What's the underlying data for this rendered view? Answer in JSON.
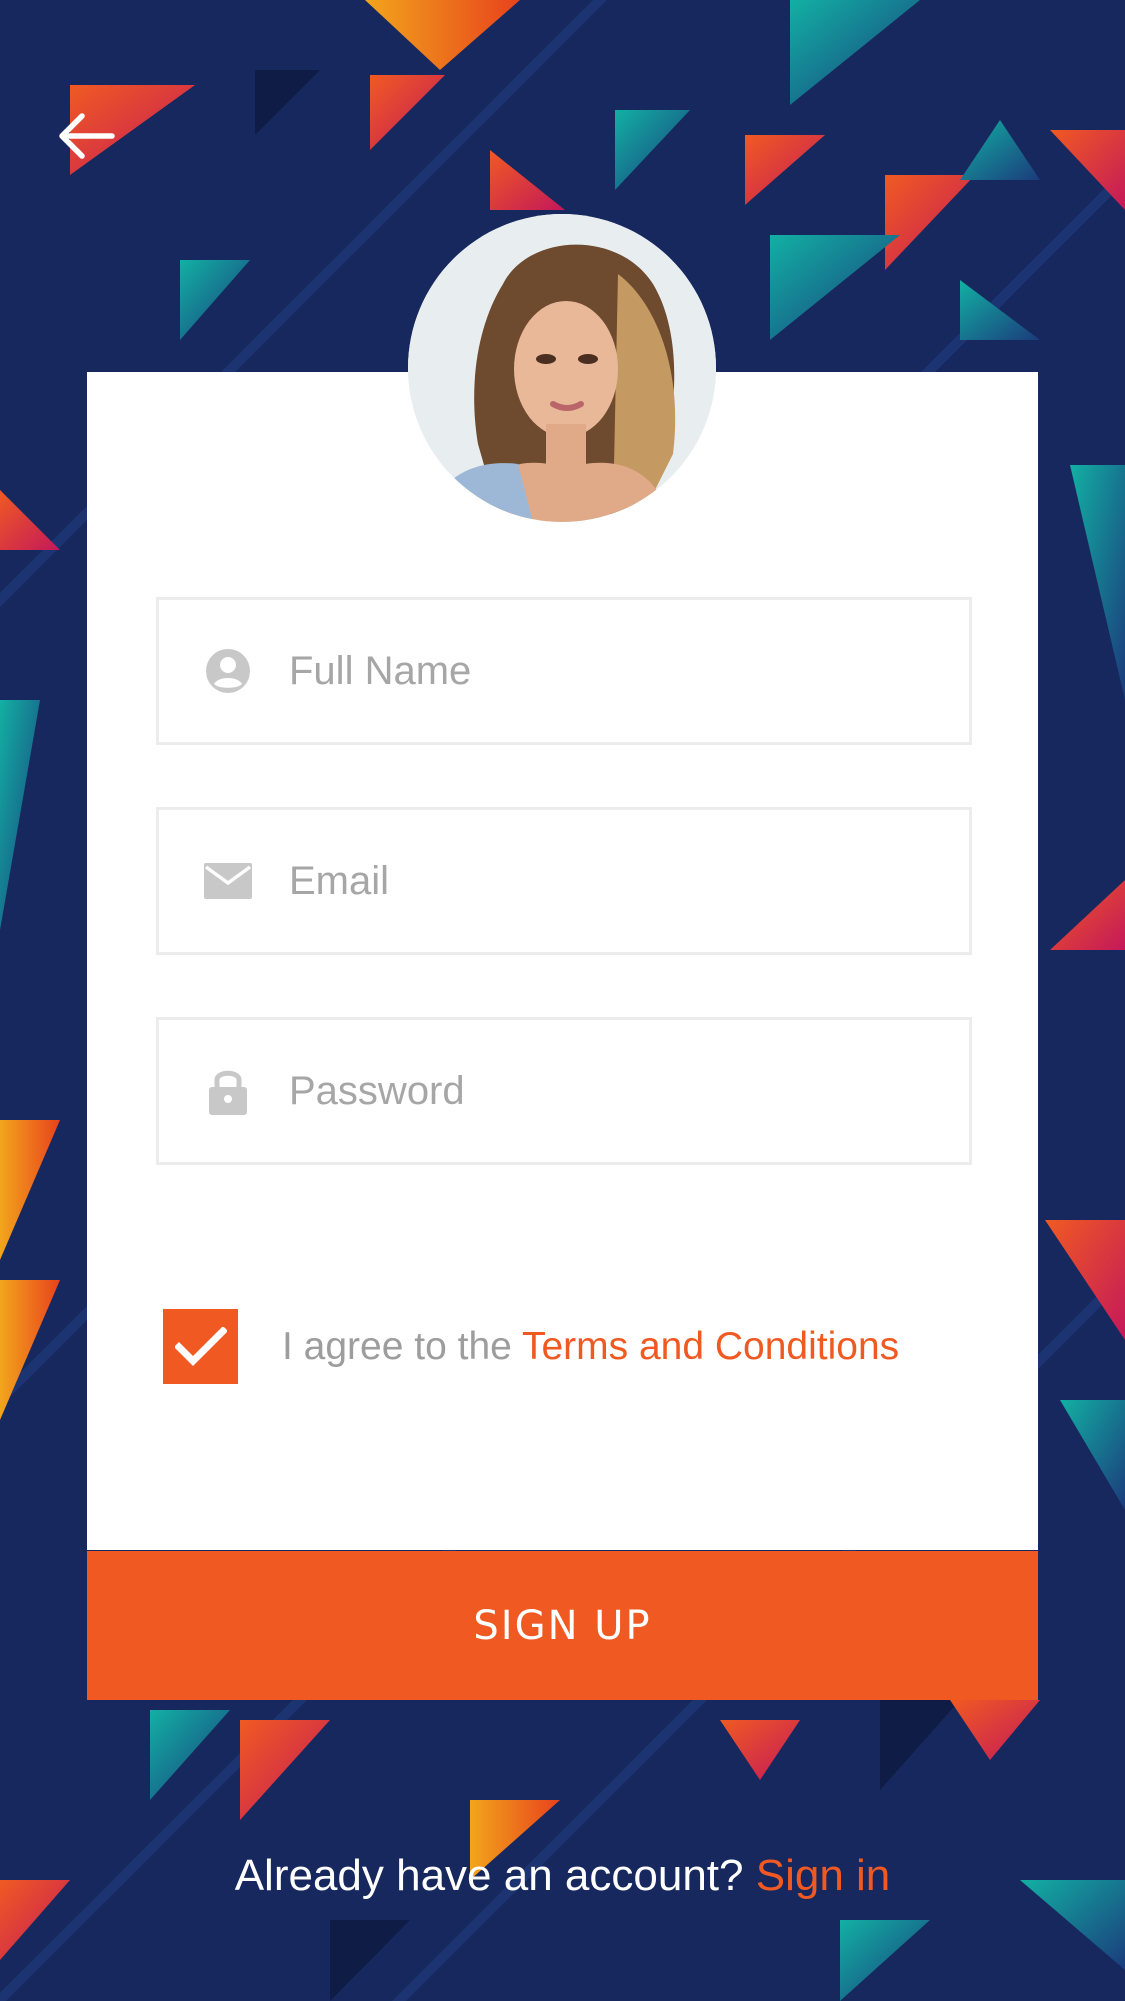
{
  "colors": {
    "background": "#16285e",
    "accent": "#f05a22",
    "card": "#ffffff",
    "field_border": "#ececec",
    "placeholder": "#a6a6a6"
  },
  "header": {
    "back_icon": "arrow-left-icon"
  },
  "profile": {
    "avatar_icon": "user-photo"
  },
  "form": {
    "full_name": {
      "placeholder": "Full Name",
      "value": "",
      "icon": "user-circle-icon"
    },
    "email": {
      "placeholder": "Email",
      "value": "",
      "icon": "envelope-icon"
    },
    "password": {
      "placeholder": "Password",
      "value": "",
      "icon": "lock-icon"
    }
  },
  "agreement": {
    "checked": true,
    "check_icon": "checkmark-icon",
    "prefix": "I agree to the ",
    "link": "Terms and Conditions"
  },
  "signup_button": {
    "label": "SIGN UP"
  },
  "footer": {
    "prompt": "Already have an account? ",
    "link": "Sign in"
  }
}
